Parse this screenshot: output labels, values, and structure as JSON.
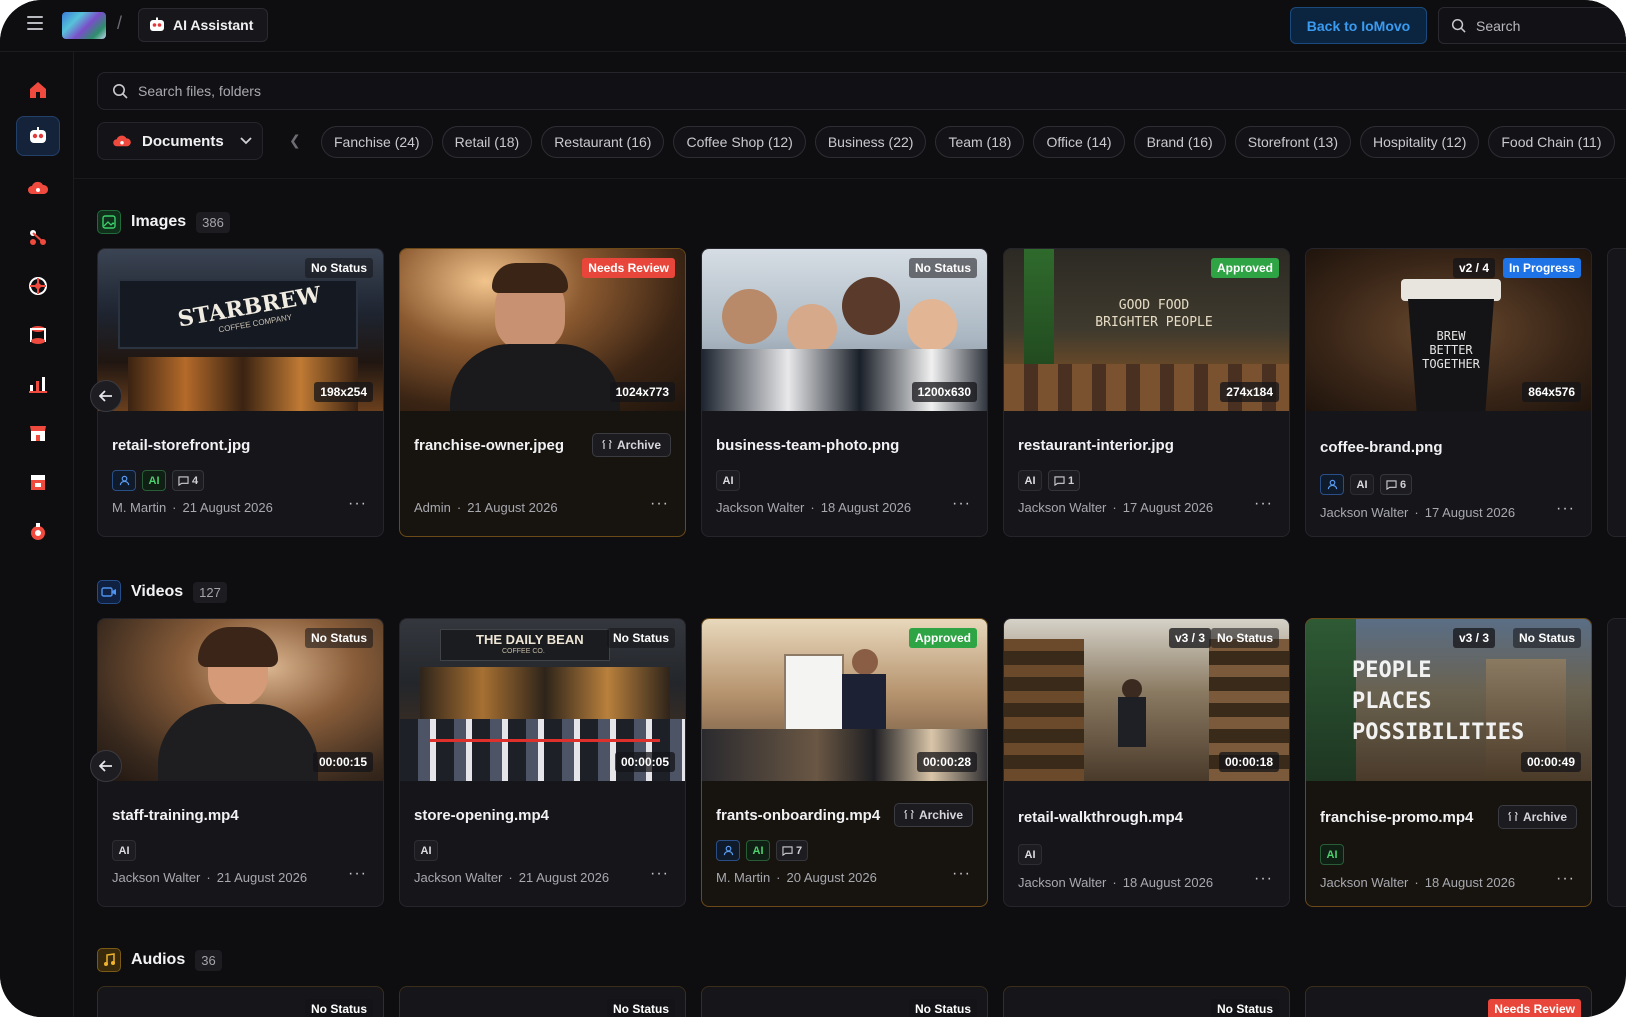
{
  "topbar": {
    "title": "AI Assistant",
    "breadcrumb_sep": "/",
    "back_label": "Back to IoMovo",
    "search_placeholder": "Search"
  },
  "search": {
    "placeholder": "Search files, folders"
  },
  "filter": {
    "scope_label": "Documents",
    "chips": [
      "Fanchise (24)",
      "Retail (18)",
      "Restaurant (16)",
      "Coffee Shop (12)",
      "Business (22)",
      "Team (18)",
      "Office (14)",
      "Brand (16)",
      "Storefront (13)",
      "Hospitality (12)",
      "Food Chain (11)"
    ]
  },
  "sidebar": {
    "icons": [
      "home-icon",
      "ai-assistant-icon",
      "cloud-icon",
      "share-icon",
      "globe-icon",
      "database-icon",
      "analytics-icon",
      "store-icon",
      "shop-icon",
      "settings-icon"
    ]
  },
  "images": {
    "title": "Images",
    "count": "386",
    "cards": [
      {
        "name": "retail-storefront.jpg",
        "status": "No Status",
        "dims": "198x254",
        "user_badge": true,
        "ai": "AI",
        "comments": "4",
        "owner": "M. Martin",
        "date": "21 August 2026",
        "highlight": false
      },
      {
        "name": "franchise-owner.jpeg",
        "status": "Needs Review",
        "dims": "1024x773",
        "archive": "Archive",
        "owner": "Admin",
        "date": "21 August 2026",
        "highlight": true
      },
      {
        "name": "business-team-photo.png",
        "status": "No Status",
        "dims": "1200x630",
        "ai": "AI",
        "owner": "Jackson Walter",
        "date": "18 August 2026",
        "highlight": false
      },
      {
        "name": "restaurant-interior.jpg",
        "status": "Approved",
        "dims": "274x184",
        "ai": "AI",
        "comments": "1",
        "owner": "Jackson Walter",
        "date": "17 August 2026",
        "highlight": false
      },
      {
        "name": "coffee-brand.png",
        "status": "In Progress",
        "version": "v2 / 4",
        "dims": "864x576",
        "user_badge": true,
        "ai": "AI",
        "comments": "6",
        "owner": "Jackson Walter",
        "date": "17 August 2026",
        "highlight": false
      }
    ]
  },
  "videos": {
    "title": "Videos",
    "count": "127",
    "cards": [
      {
        "name": "staff-training.mp4",
        "status": "No Status",
        "duration": "00:00:15",
        "ai": "AI",
        "owner": "Jackson Walter",
        "date": "21 August 2026",
        "highlight": false
      },
      {
        "name": "store-opening.mp4",
        "status": "No Status",
        "duration": "00:00:05",
        "ai": "AI",
        "owner": "Jackson Walter",
        "date": "21 August 2026",
        "highlight": false
      },
      {
        "name": "frants-onboarding.mp4",
        "status": "Approved",
        "duration": "00:00:28",
        "archive": "Archive",
        "user_badge": true,
        "ai": "AI",
        "comments": "7",
        "owner": "M. Martin",
        "date": "20 August 2026",
        "highlight": true
      },
      {
        "name": "retail-walkthrough.mp4",
        "status": "No Status",
        "version": "v3 / 3",
        "duration": "00:00:18",
        "ai": "AI",
        "owner": "Jackson Walter",
        "date": "18 August 2026",
        "highlight": false
      },
      {
        "name": "franchise-promo.mp4",
        "status": "No Status",
        "version": "v3 / 3",
        "duration": "00:00:49",
        "archive": "Archive",
        "ai": "AI",
        "owner": "Jackson Walter",
        "date": "18 August 2026",
        "highlight": true
      }
    ]
  },
  "audios": {
    "title": "Audios",
    "count": "36",
    "statuses": [
      "No Status",
      "No Status",
      "No Status",
      "No Status",
      "Needs Review"
    ]
  },
  "thumb_text": {
    "starbrew": "STARBREW",
    "starbrew_sub": "COFFEE COMPANY",
    "goodfood": "GOOD FOOD\nBRIGHTER PEOPLE",
    "brew": "BREW\nBETTER\nTOGETHER",
    "dailybean": "THE DAILY BEAN",
    "dailybean_sub": "COFFEE CO.",
    "people": "PEOPLE\nPLACES\nPOSSIBILITIES"
  },
  "colors": {
    "accent": "#3a9bf0",
    "review": "#e8463a",
    "approved": "#2fa445",
    "progress": "#1e74e6"
  }
}
